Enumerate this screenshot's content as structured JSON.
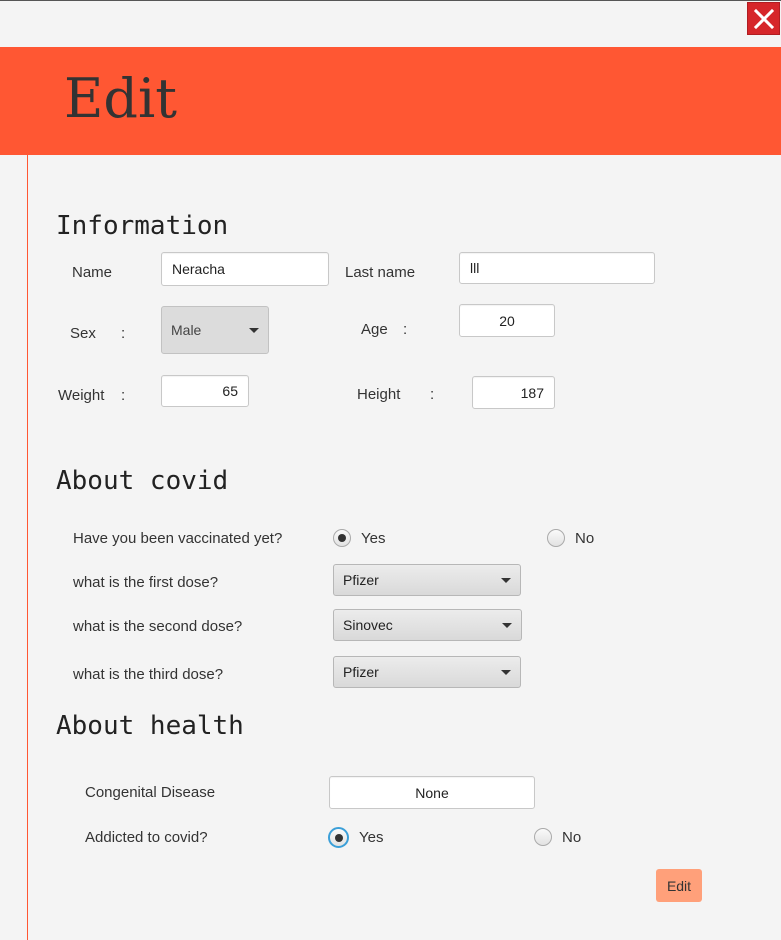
{
  "window": {
    "close_label": "X"
  },
  "header": {
    "title": "Edit"
  },
  "information": {
    "title": "Information",
    "name_label": "Name",
    "name_value": "Neracha",
    "lastname_label": "Last name",
    "lastname_value": "lll",
    "sex_label": "Sex",
    "sex_value": "Male",
    "age_label": "Age",
    "age_value": "20",
    "weight_label": "Weight",
    "weight_value": "65",
    "height_label": "Height",
    "height_value": "187",
    "colon": ":"
  },
  "covid": {
    "title": "About covid",
    "vaccinated_question": "Have you been vaccinated yet?",
    "yes_label": "Yes",
    "no_label": "No",
    "vaccinated": "Yes",
    "first_dose_label": "what is the first dose?",
    "first_dose_value": "Pfizer",
    "second_dose_label": "what is the second dose?",
    "second_dose_value": "Sinovec",
    "third_dose_label": "what is the third dose?",
    "third_dose_value": "Pfizer"
  },
  "health": {
    "title": "About health",
    "congenital_label": "Congenital Disease",
    "congenital_value": "None",
    "addicted_question": "Addicted to covid?",
    "yes_label": "Yes",
    "no_label": "No",
    "addicted": "Yes"
  },
  "actions": {
    "edit_label": "Edit"
  },
  "colors": {
    "banner": "#ff5733",
    "close": "#d6262a",
    "edit_button": "#ffa07a",
    "focus": "#3b9fd8"
  }
}
